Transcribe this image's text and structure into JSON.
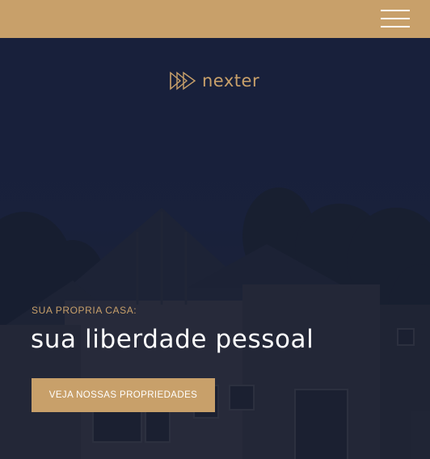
{
  "colors": {
    "accent": "#c8a06a",
    "hero_bg": "#1c2540",
    "text": "#ffffff"
  },
  "header": {
    "menu_icon": "hamburger-menu-icon"
  },
  "logo": {
    "icon": "triple-play-arrow-icon",
    "text": "nexter"
  },
  "hero": {
    "eyebrow": "SUA PROPRIA CASA:",
    "headline": "sua liberdade pessoal",
    "cta_label": "VEJA NOSSAS PROPRIEDADES"
  }
}
